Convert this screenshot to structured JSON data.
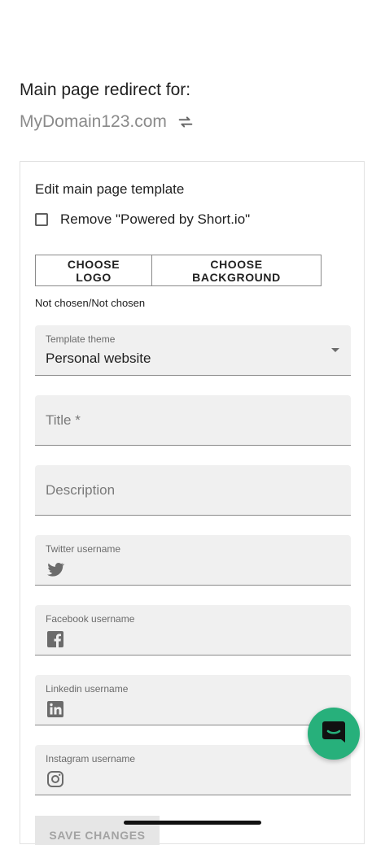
{
  "header": {
    "title": "Main page redirect for:",
    "domain": "MyDomain123.com"
  },
  "card": {
    "title": "Edit main page template",
    "remove_powered_label": "Remove \"Powered by Short.io\"",
    "remove_powered_checked": false,
    "choose_logo_label": "CHOOSE LOGO",
    "choose_background_label": "CHOOSE BACKGROUND",
    "chosen_status": "Not chosen/Not chosen"
  },
  "fields": {
    "theme": {
      "label": "Template theme",
      "value": "Personal website"
    },
    "title": {
      "placeholder": "Title *"
    },
    "description": {
      "placeholder": "Description"
    },
    "twitter": {
      "label": "Twitter username",
      "icon": "twitter-icon"
    },
    "facebook": {
      "label": "Facebook username",
      "icon": "facebook-icon"
    },
    "linkedin": {
      "label": "Linkedin username",
      "icon": "linkedin-icon"
    },
    "instagram": {
      "label": "Instagram username",
      "icon": "instagram-icon"
    }
  },
  "actions": {
    "save_label": "SAVE CHANGES"
  },
  "colors": {
    "accent": "#27b07b",
    "field_bg": "#f0f0f0",
    "muted": "#8a8a8a"
  }
}
